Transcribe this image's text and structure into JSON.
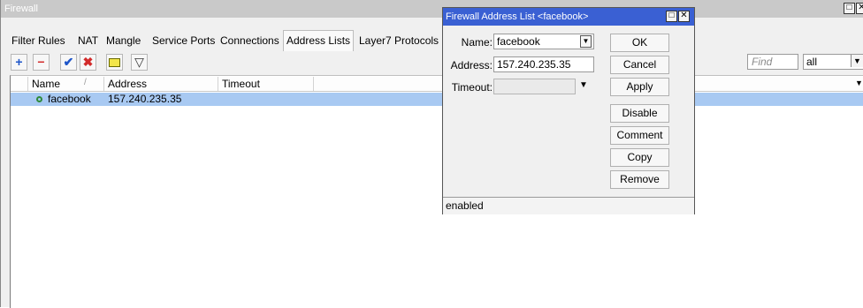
{
  "window": {
    "title": "Firewall",
    "maximize_glyph": "□",
    "close_glyph": "✕"
  },
  "tabs": [
    {
      "label": "Filter Rules"
    },
    {
      "label": "NAT"
    },
    {
      "label": "Mangle"
    },
    {
      "label": "Service Ports"
    },
    {
      "label": "Connections"
    },
    {
      "label": "Address Lists",
      "active": true
    },
    {
      "label": "Layer7 Protocols"
    }
  ],
  "toolbar": {
    "add_icon": "plus-icon",
    "add_glyph": "+",
    "remove_icon": "minus-icon",
    "remove_glyph": "−",
    "enable_icon": "check-icon",
    "enable_glyph": "✔",
    "disable_icon": "x-icon",
    "disable_glyph": "✖",
    "comment_icon": "note-icon",
    "filter_icon": "filter-icon",
    "filter_glyph": "▽",
    "find_placeholder": "Find",
    "filter_value": "all",
    "filter_arrow": "▼"
  },
  "list": {
    "columns": [
      {
        "label": "Name"
      },
      {
        "label": "Address"
      },
      {
        "label": "Timeout"
      }
    ],
    "sort_indicator": "/",
    "dropdown_arrow": "▼",
    "rows": [
      {
        "name": "facebook",
        "address": "157.240.235.35",
        "timeout": ""
      }
    ]
  },
  "dialog": {
    "title": "Firewall Address List <facebook>",
    "fields": {
      "name_label": "Name:",
      "name_value": "facebook",
      "address_label": "Address:",
      "address_value": "157.240.235.35",
      "timeout_label": "Timeout:",
      "timeout_value": ""
    },
    "spin_glyph": "▼",
    "dropdown_glyph": "▼",
    "buttons": {
      "ok": "OK",
      "cancel": "Cancel",
      "apply": "Apply",
      "disable": "Disable",
      "comment": "Comment",
      "copy": "Copy",
      "remove": "Remove"
    },
    "status": "enabled"
  },
  "colors": {
    "dialog_title_bg": "#3a60d3",
    "selected_row_bg": "#a8c9f2",
    "main_title_bg": "#c9c9c9",
    "add_blue": "#1f56c9",
    "remove_red": "#d22b2b",
    "check_blue": "#1f56c9",
    "x_red": "#d22b2b",
    "note_yellow": "#f3e64a"
  }
}
